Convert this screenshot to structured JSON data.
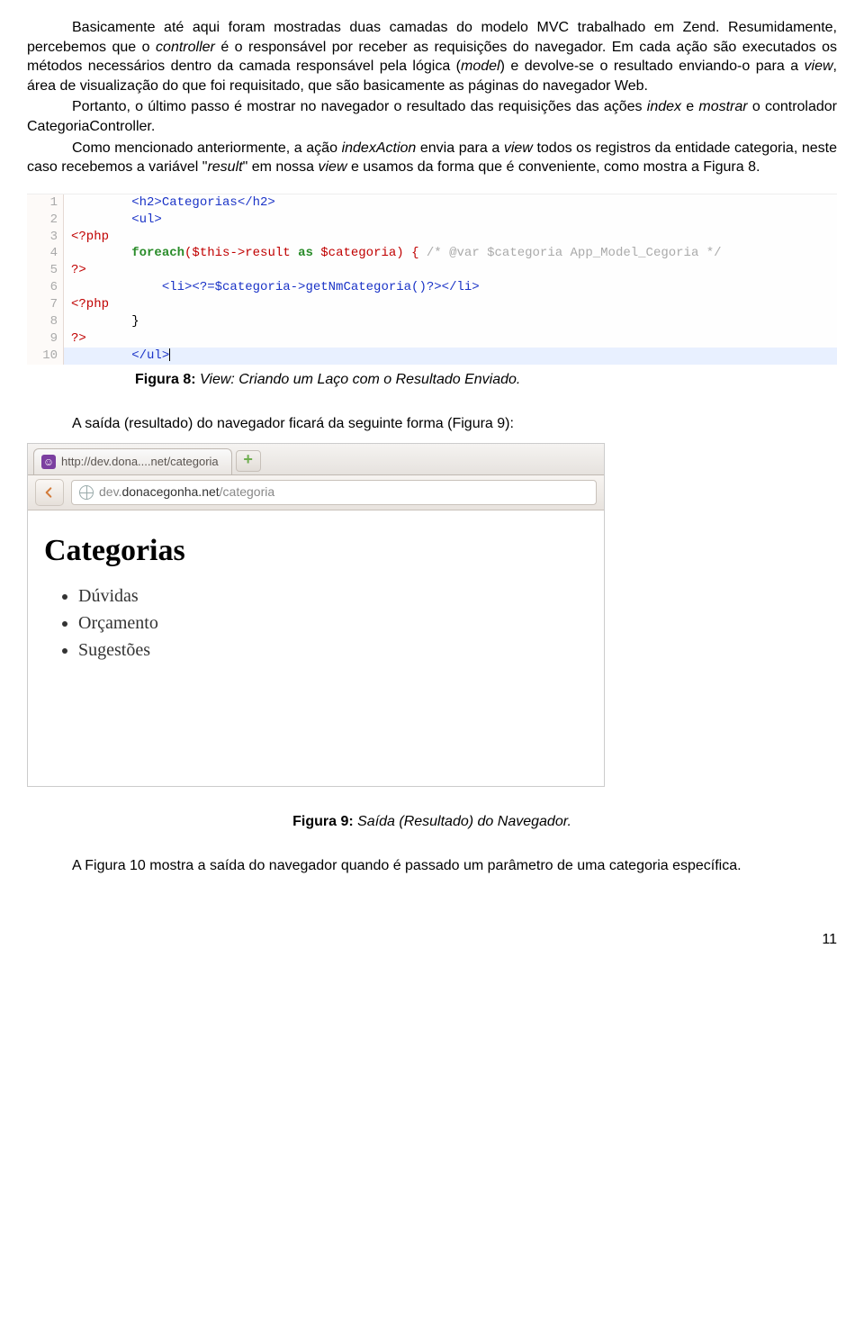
{
  "paragraphs": {
    "p1_a": "Basicamente até aqui foram mostradas duas camadas do modelo MVC trabalhado em Zend. Resumidamente, percebemos que o ",
    "p1_b": "controller",
    "p1_c": " é o responsável por receber as requisições do navegador. Em cada ação são executados os métodos necessários dentro da camada responsável pela lógica (",
    "p1_d": "model",
    "p1_e": ") e devolve-se o resultado enviando-o para a ",
    "p1_f": "view",
    "p1_g": ", área de visualização do que foi requisitado, que são basicamente as páginas do navegador Web.",
    "p2_a": "Portanto, o último passo é mostrar no navegador o resultado das requisições das ações ",
    "p2_b": "index",
    "p2_c": " e ",
    "p2_d": "mostrar",
    "p2_e": " o controlador CategoriaController.",
    "p3_a": "Como mencionado anteriormente, a ação ",
    "p3_b": "indexAction",
    "p3_c": " envia para a ",
    "p3_d": "view",
    "p3_e": " todos os registros da entidade categoria, neste caso recebemos a variável \"",
    "p3_f": "result",
    "p3_g": "\" em nossa ",
    "p3_h": "view",
    "p3_i": " e usamos da forma que é conveniente, como mostra a Figura 8.",
    "p4": "A saída (resultado) do navegador ficará da seguinte forma (Figura 9):",
    "p5": "A Figura 10 mostra a saída do navegador quando é passado um parâmetro de uma categoria específica."
  },
  "code": {
    "l1": "        <h2>Categorias</h2>",
    "l2": "        <ul>",
    "l3": "<?php",
    "l4a": "        foreach",
    "l4b": "($this->result ",
    "l4c": "as",
    "l4d": " $categoria) { ",
    "l4e": "/* @var $categoria App_Model_Cegoria */",
    "l5": "?>",
    "l6": "            <li><?=$categoria->getNmCategoria()?></li>",
    "l7": "<?php",
    "l8": "        }",
    "l9": "?>",
    "l10": "        </ul>"
  },
  "captions": {
    "fig8_bold": "Figura 8:",
    "fig8_ital": " View: Criando um Laço com o Resultado Enviado.",
    "fig9_bold": "Figura 9:",
    "fig9_ital": " Saída (Resultado) do Navegador."
  },
  "browser": {
    "tab_title": "http://dev.dona....net/categoria",
    "url_prefix": "dev.",
    "url_host": "donacegonha.net",
    "url_path": "/categoria",
    "page_heading": "Categorias",
    "items": [
      "Dúvidas",
      "Orçamento",
      "Sugestões"
    ]
  },
  "page_number": "11"
}
